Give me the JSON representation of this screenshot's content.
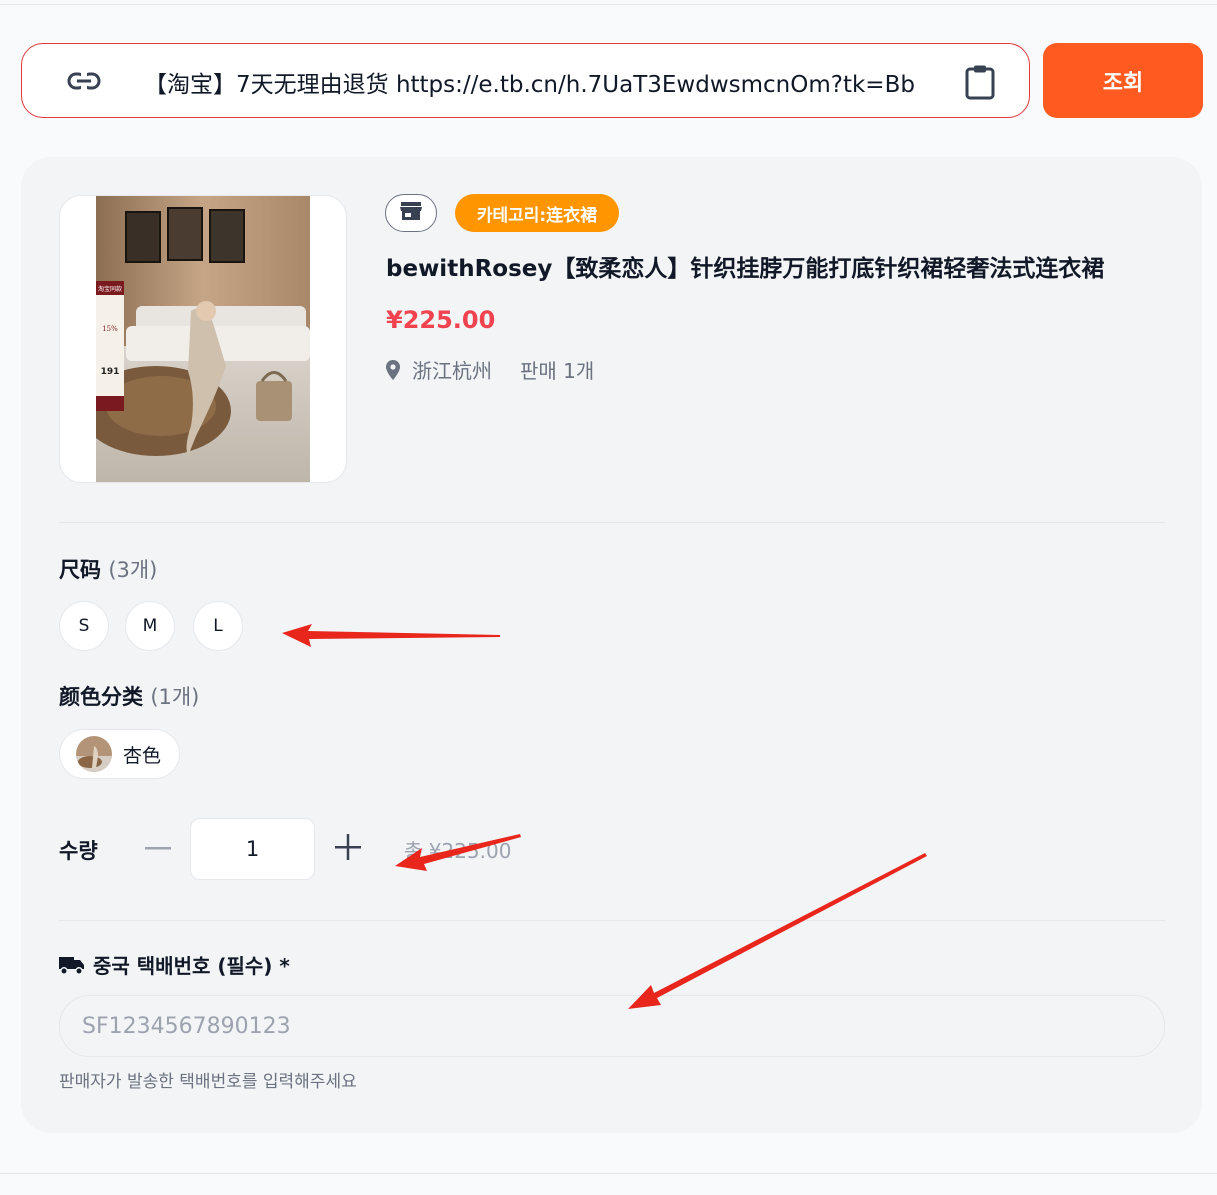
{
  "search": {
    "url_value": "【淘宝】7天无理由退货 https://e.tb.cn/h.7UaT3EwdwsmcnOm?tk=Bb",
    "button_label": "조회"
  },
  "product": {
    "category_prefix": "카테고리: ",
    "category": "连衣裙",
    "title": "bewithRosey【致柔恋人】针织挂脖万能打底针织裙轻奢法式连衣裙",
    "price": "¥225.00",
    "location": "浙江杭州",
    "sales": "판매 1개",
    "image_badge": {
      "header": "淘宝同款",
      "pct": "15%",
      "num": "191"
    }
  },
  "options": {
    "size": {
      "label": "尺码",
      "count": "(3개)",
      "values": [
        "S",
        "M",
        "L"
      ]
    },
    "color": {
      "label": "颜色分类",
      "count": "(1개)",
      "values": [
        "杏色"
      ]
    }
  },
  "quantity": {
    "label": "수량",
    "value": "1",
    "total": "총 ¥225.00"
  },
  "tracking": {
    "label": "중국 택배번호 (필수) *",
    "placeholder": "SF1234567890123",
    "helper": "판매자가 발송한 택배번호를 입력해주세요"
  },
  "colors": {
    "accent": "#ff5a1f",
    "badge": "#ff9500",
    "price": "#f0434f",
    "annotation": "#e8261c"
  },
  "icons": [
    "link-icon",
    "clipboard-icon",
    "store-icon",
    "location-pin-icon",
    "truck-icon",
    "minus-icon",
    "plus-icon"
  ]
}
